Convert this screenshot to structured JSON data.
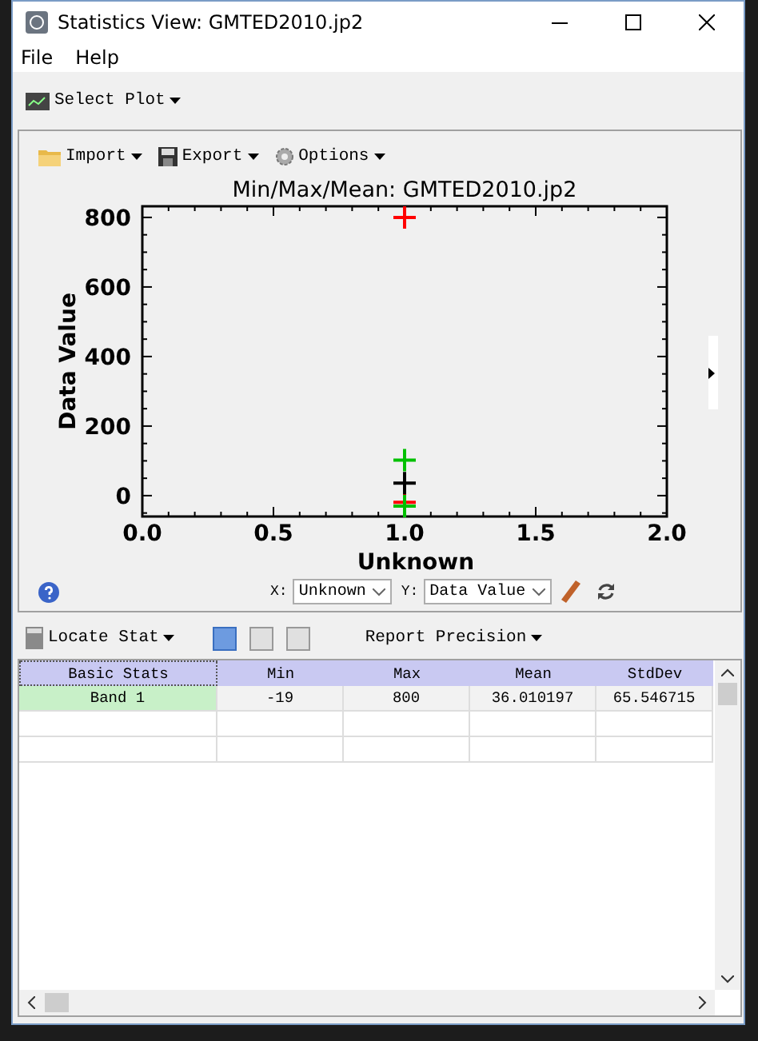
{
  "window": {
    "title": "Statistics View: GMTED2010.jp2"
  },
  "menu": [
    "File",
    "Help"
  ],
  "top_toolbar": {
    "select_plot": "Select Plot"
  },
  "plot_panel": {
    "toolbar": [
      "Import",
      "Export",
      "Options"
    ],
    "chart_data": {
      "type": "scatter",
      "title": "Min/Max/Mean: GMTED2010.jp2",
      "xlabel": "Unknown",
      "ylabel": "Data Value",
      "x": [
        1
      ],
      "xlim": [
        0,
        2
      ],
      "ylim": [
        -60,
        832
      ],
      "xticks": [
        {
          "value": 0,
          "label": "0.0"
        },
        {
          "value": 0.5,
          "label": "0.5"
        },
        {
          "value": 1,
          "label": "1.0"
        },
        {
          "value": 1.5,
          "label": "1.5"
        },
        {
          "value": 2,
          "label": "2.0"
        }
      ],
      "yticks": [
        0,
        200,
        400,
        600,
        800
      ],
      "series": [
        {
          "color": "#ff0000",
          "values": [
            800
          ]
        },
        {
          "color": "#ff0000",
          "values": [
            -19
          ]
        },
        {
          "color": "#000000",
          "values": [
            36
          ]
        },
        {
          "color": "#00c000",
          "values": [
            102
          ]
        },
        {
          "color": "#00c000",
          "values": [
            -30
          ]
        }
      ]
    },
    "x_axis": {
      "label": "X:",
      "value": "Unknown"
    },
    "y_axis": {
      "label": "Y:",
      "value": "Data Value"
    }
  },
  "stats_toolbar": {
    "locate_stat": "Locate Stat",
    "views": [
      {
        "selected": true
      },
      {
        "selected": false
      },
      {
        "selected": false
      }
    ],
    "report_precision": "Report Precision"
  },
  "table": {
    "columns": [
      "Basic Stats",
      "Min",
      "Max",
      "Mean",
      "StdDev"
    ],
    "rows": [
      [
        "Band 1",
        "-19",
        "800",
        "36.010197",
        "65.546715"
      ]
    ]
  }
}
